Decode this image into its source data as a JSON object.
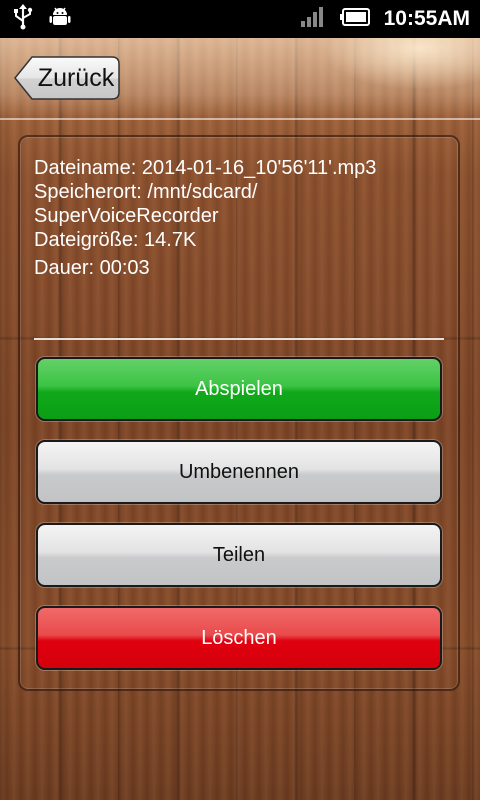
{
  "status_bar": {
    "time": "10:55AM",
    "left_icons": [
      "usb-icon",
      "android-debug-icon"
    ],
    "right_icons": [
      "signal-icon",
      "battery-icon"
    ]
  },
  "header": {
    "back_label": "Zurück"
  },
  "file_info": {
    "filename_line": "Dateiname: 2014-01-16_10'56'11'.mp3",
    "location_line_1": "Speicherort: /mnt/sdcard/",
    "location_line_2": "SuperVoiceRecorder",
    "size_line": "Dateigröße: 14.7K",
    "duration_line": "Dauer: 00:03"
  },
  "actions": {
    "play_label": "Abspielen",
    "rename_label": "Umbenennen",
    "share_label": "Teilen",
    "delete_label": "Löschen"
  },
  "colors": {
    "play": "#1fb427",
    "delete": "#e10010",
    "neutral": "#d4d5d7"
  }
}
